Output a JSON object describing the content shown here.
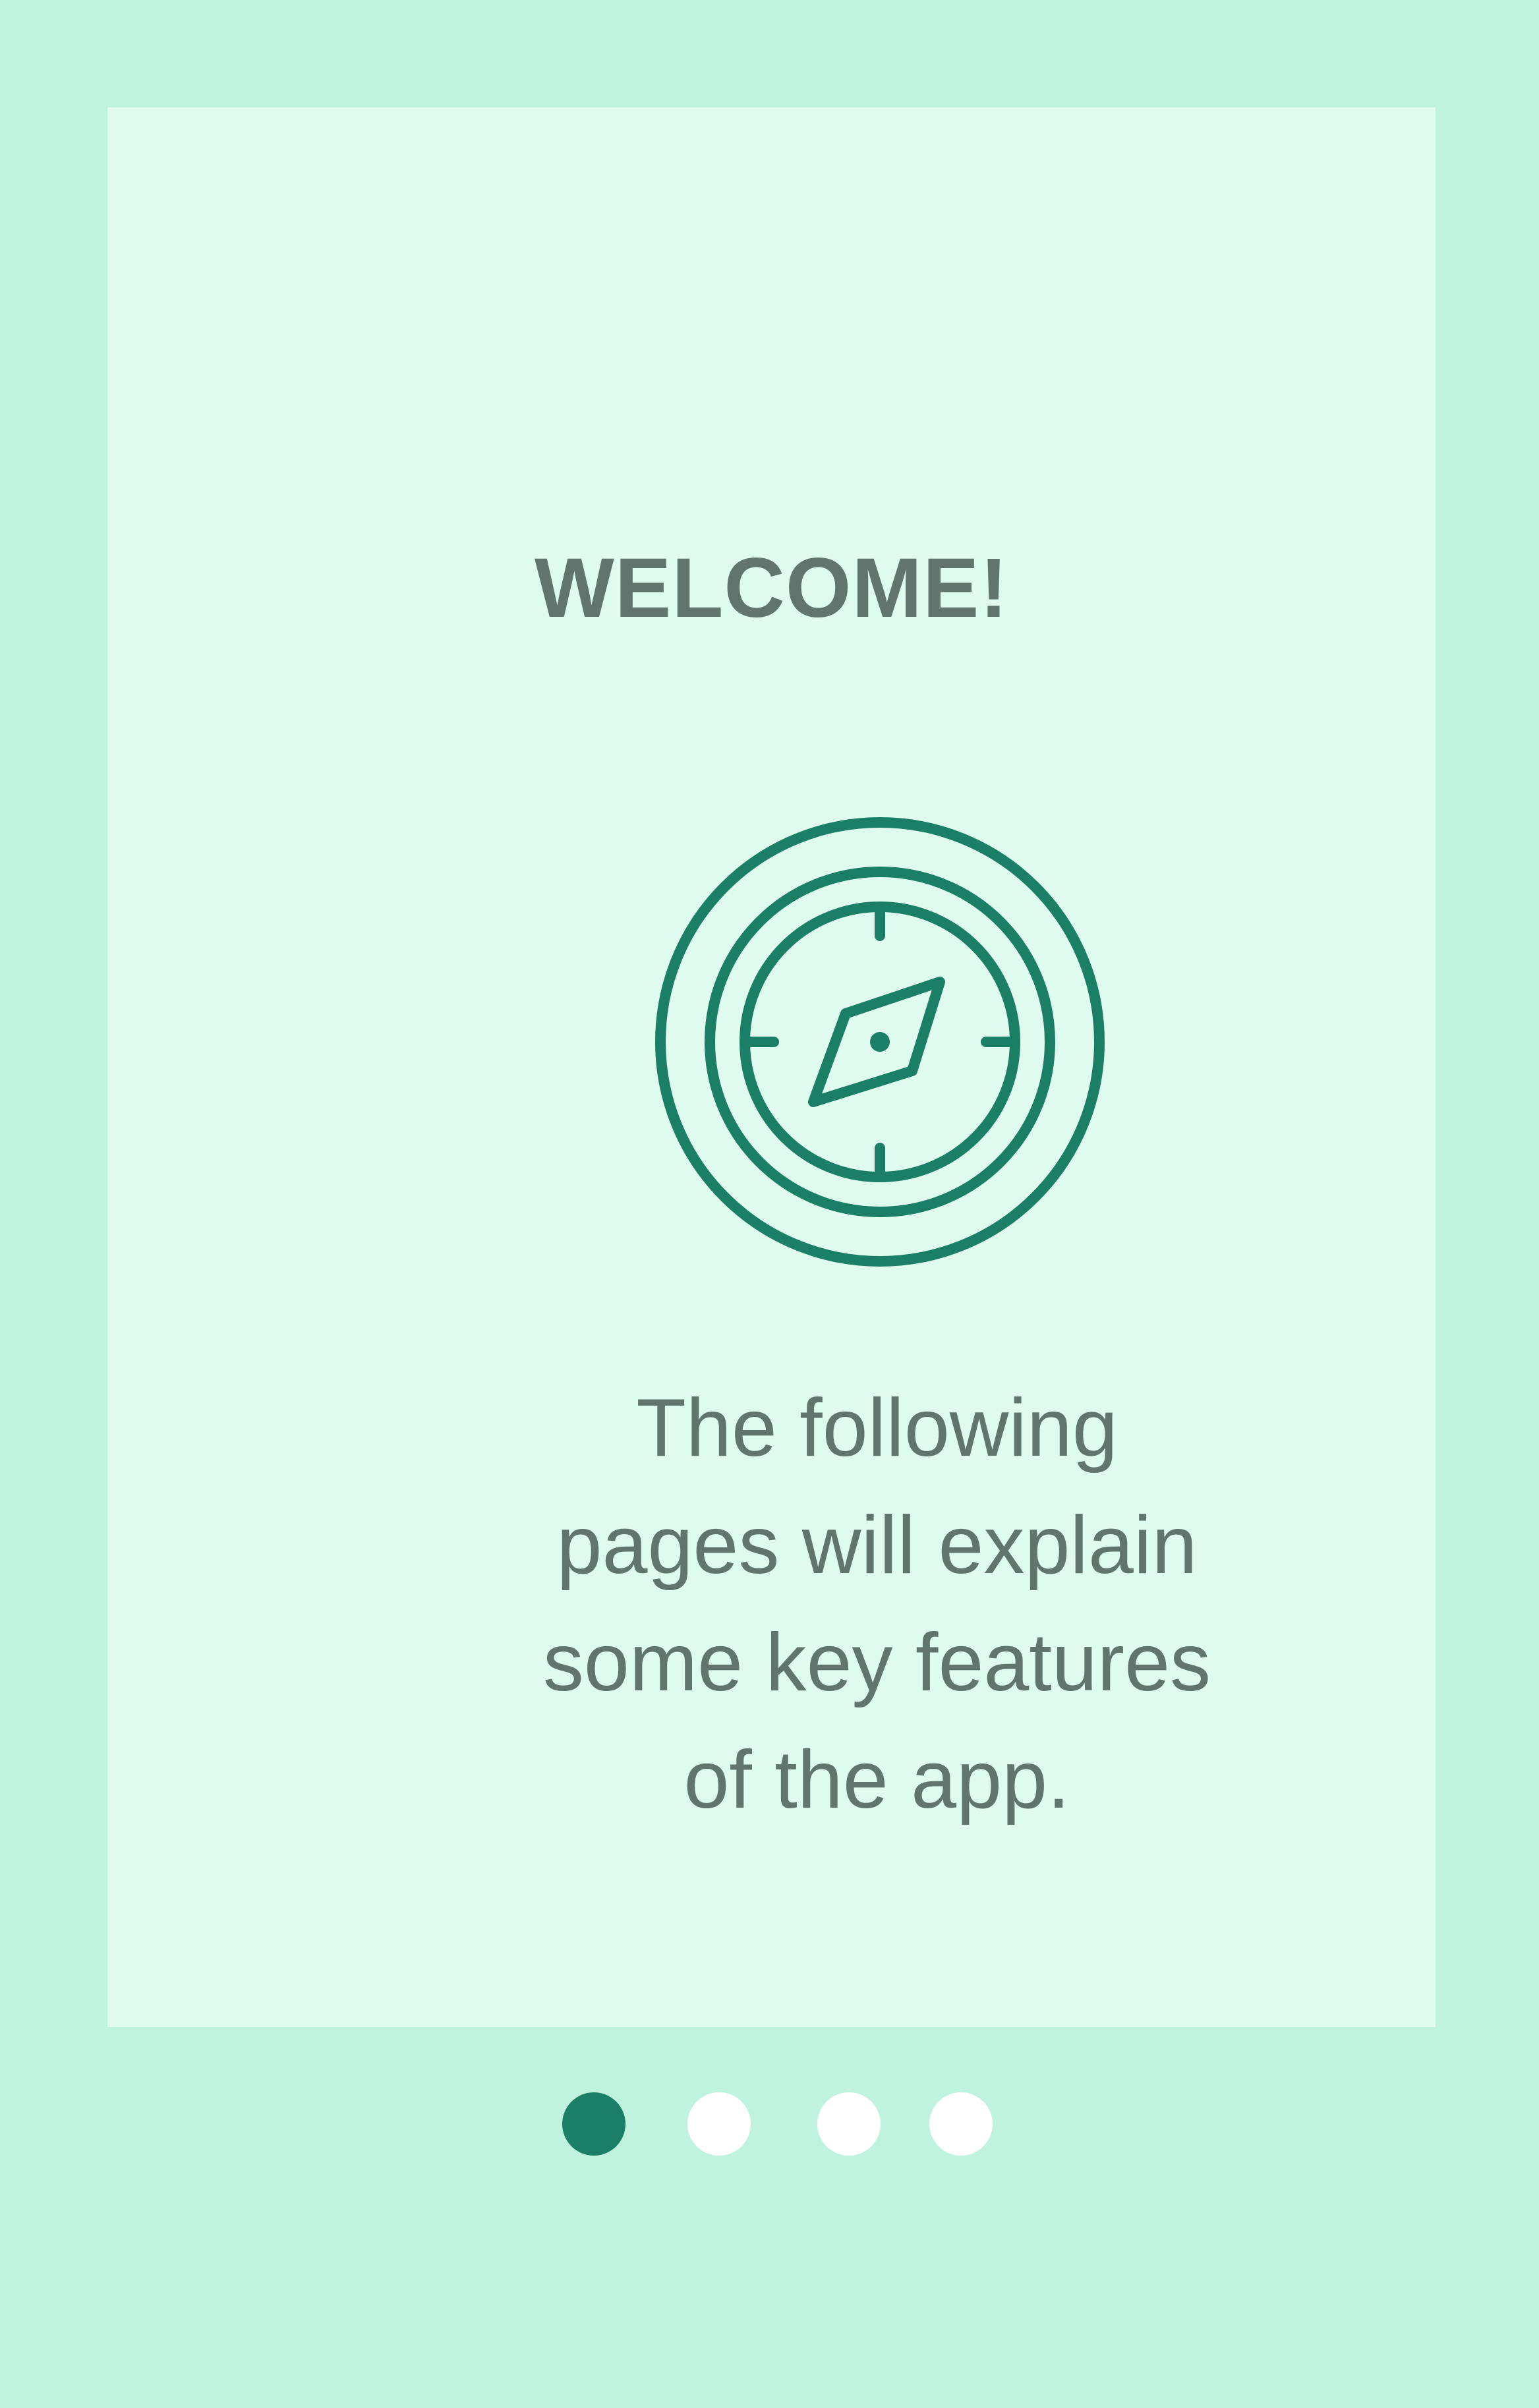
{
  "onboarding": {
    "title": "WELCOME!",
    "icon": "compass-icon",
    "description_lines": [
      "The following",
      "pages will explain",
      "some key features",
      "of the app."
    ]
  },
  "pagination": {
    "total_pages": 4,
    "current_page": 1
  },
  "colors": {
    "background": "#c0f3df",
    "card": "#dffaef",
    "accent": "#1a7f64",
    "text": "#5f756d",
    "inactive_dot": "#ffffff"
  }
}
